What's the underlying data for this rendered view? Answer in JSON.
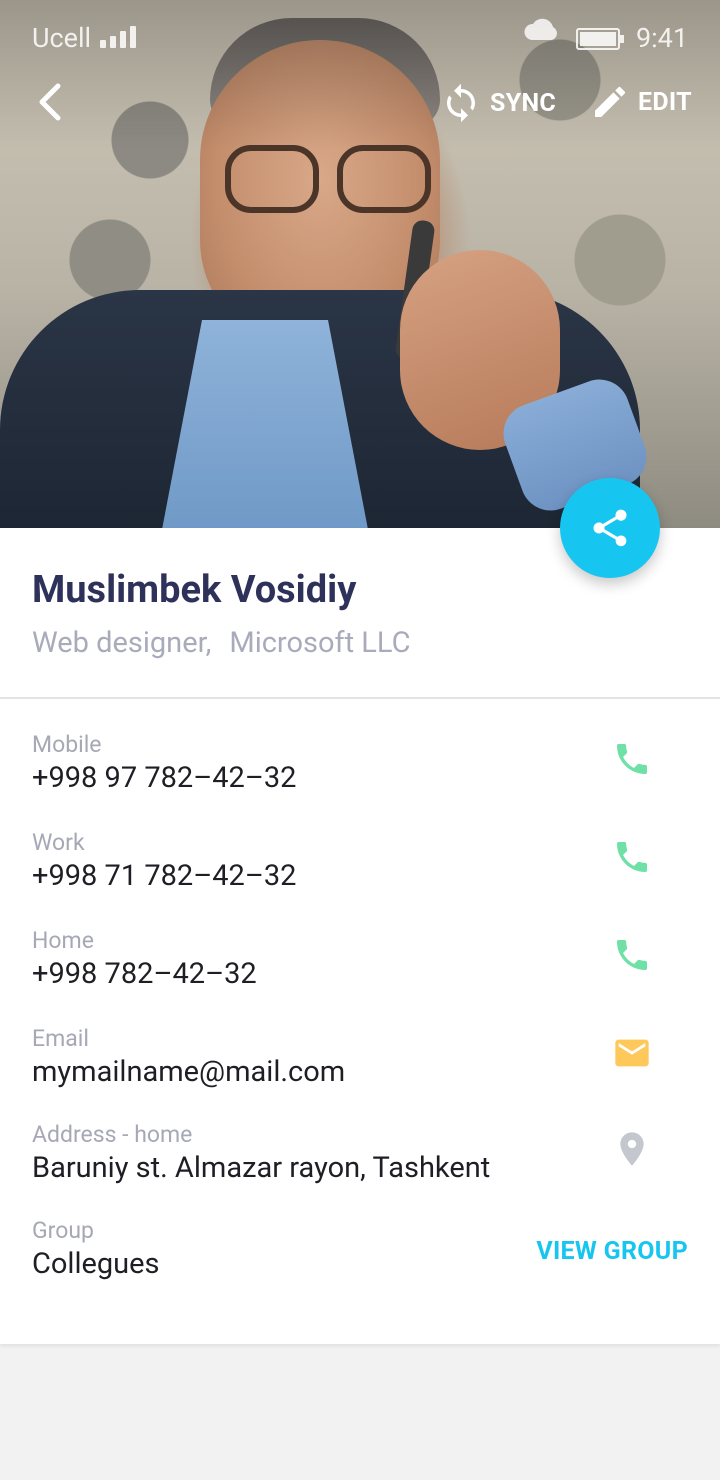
{
  "status_bar": {
    "carrier": "Ucell",
    "time": "9:41"
  },
  "app_bar": {
    "sync_label": "SYNC",
    "edit_label": "EDIT"
  },
  "contact": {
    "name": "Muslimbek Vosidiy",
    "job_title": "Web designer,",
    "company": "Microsoft LLC"
  },
  "fields": [
    {
      "label": "Mobile",
      "value": "+998 97 782–42–32",
      "action_icon": "phone-icon"
    },
    {
      "label": "Work",
      "value": "+998 71 782–42–32",
      "action_icon": "phone-icon"
    },
    {
      "label": "Home",
      "value": "+998 782–42–32",
      "action_icon": "phone-icon"
    },
    {
      "label": "Email",
      "value": "mymailname@mail.com",
      "action_icon": "mail-icon"
    },
    {
      "label": "Address - home",
      "value": "Baruniy st. Almazar rayon, Tashkent",
      "action_icon": "location-pin-icon"
    },
    {
      "label": "Group",
      "value": "Collegues",
      "action_label": "VIEW GROUP"
    }
  ],
  "colors": {
    "accent": "#17c6f0",
    "phone_icon": "#6fe0a6",
    "mail_icon": "#ffc85a",
    "pin_icon": "#c5c7cf",
    "name_text": "#2e325a"
  }
}
